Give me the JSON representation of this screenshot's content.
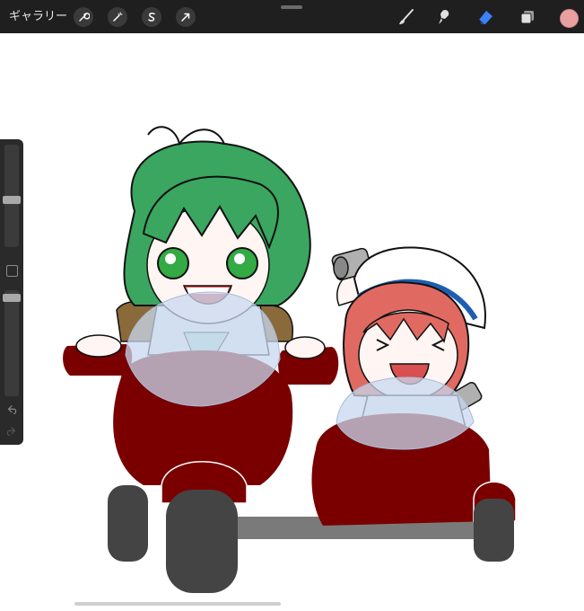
{
  "toolbar": {
    "gallery_label": "ギャラリー",
    "left_tools": [
      {
        "icon": "wrench-icon",
        "name": "actions"
      },
      {
        "icon": "magic-wand-icon",
        "name": "adjustments"
      },
      {
        "icon": "selection-s-icon",
        "name": "selection"
      },
      {
        "icon": "arrow-cursor-icon",
        "name": "transform"
      }
    ],
    "right_tools": [
      {
        "icon": "brush-icon",
        "name": "paint"
      },
      {
        "icon": "smudge-icon",
        "name": "smudge"
      },
      {
        "icon": "eraser-icon",
        "name": "erase"
      },
      {
        "icon": "layers-icon",
        "name": "layers"
      }
    ],
    "current_color": "#e8a0a0",
    "active_tool": "erase",
    "accent_color": "#3b82f6"
  },
  "sidebar": {
    "brush_size_level": 0.35,
    "opacity_level": 0.05
  },
  "canvas": {
    "background": "#ffffff",
    "palette": {
      "hair_green": "#3aa660",
      "hair_red": "#e06a62",
      "vehicle_red": "#7a0000",
      "wheel_gray": "#444444",
      "windshield": "#c8d8ef"
    }
  }
}
